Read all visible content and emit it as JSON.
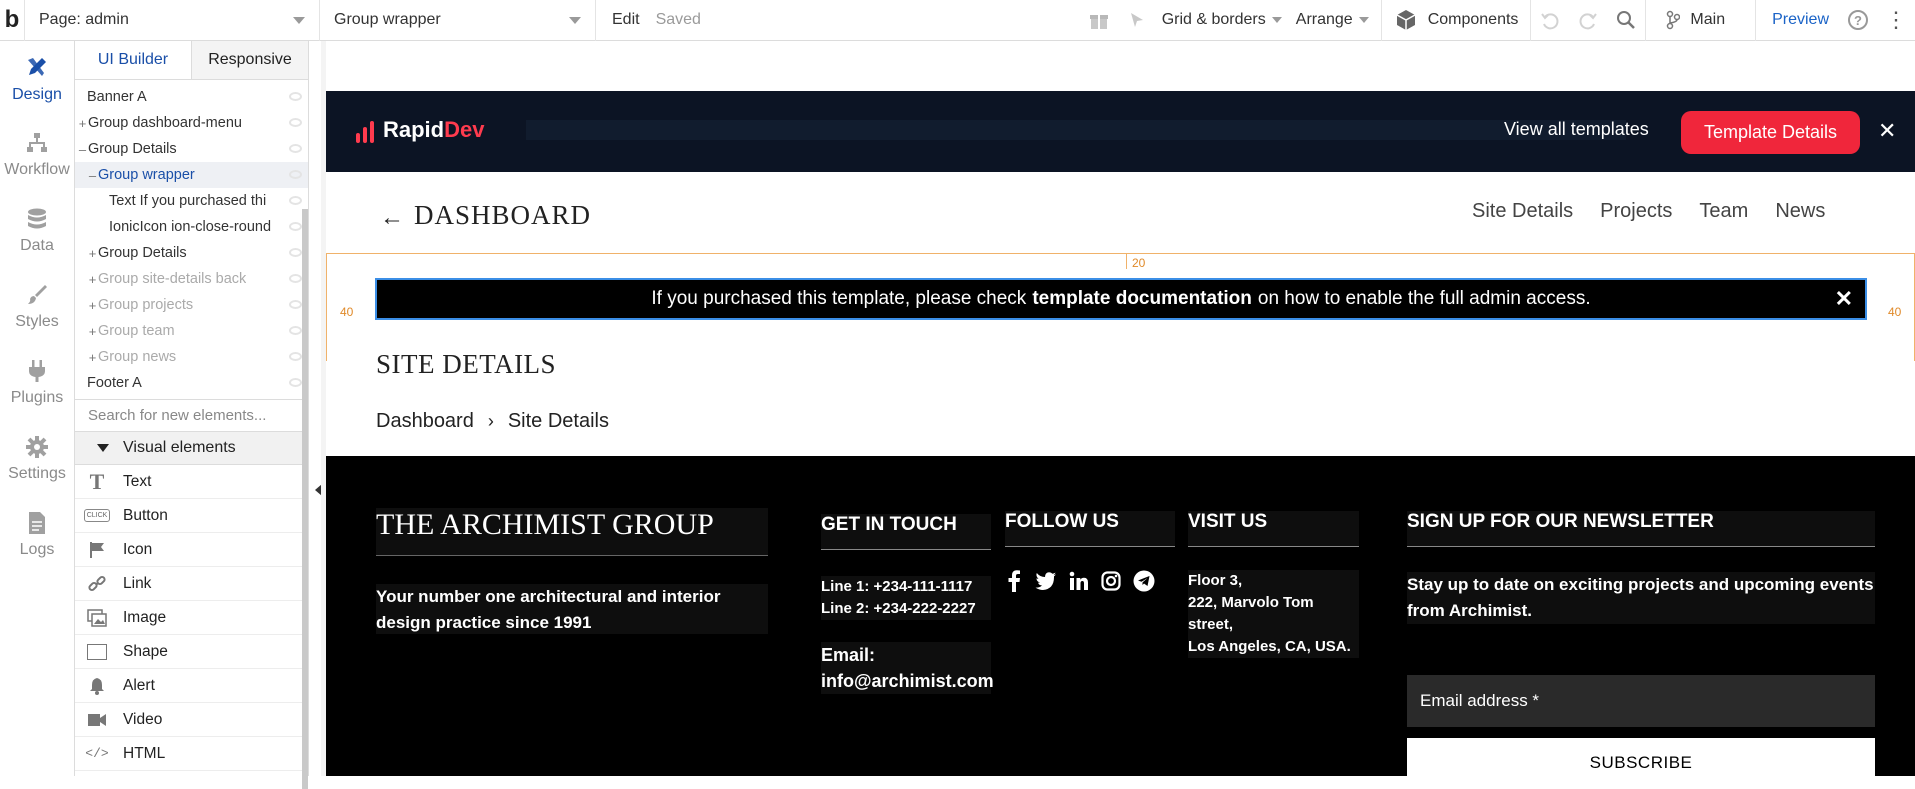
{
  "toolbar": {
    "logo": "b",
    "page_select": "Page: admin",
    "element_select": "Group wrapper",
    "edit": "Edit",
    "saved": "Saved",
    "grid_borders": "Grid & borders",
    "arrange": "Arrange",
    "components": "Components",
    "branch": "Main",
    "preview": "Preview",
    "help": "?"
  },
  "rail": {
    "items": [
      {
        "label": "Design",
        "icon": "pencil-icon"
      },
      {
        "label": "Workflow",
        "icon": "workflow-icon"
      },
      {
        "label": "Data",
        "icon": "database-icon"
      },
      {
        "label": "Styles",
        "icon": "brush-icon"
      },
      {
        "label": "Plugins",
        "icon": "plug-icon"
      },
      {
        "label": "Settings",
        "icon": "gear-icon"
      },
      {
        "label": "Logs",
        "icon": "document-icon"
      }
    ]
  },
  "panel": {
    "tabs": [
      "UI Builder",
      "Responsive"
    ],
    "tree": [
      {
        "label": "Banner A"
      },
      {
        "label": "Group dashboard-menu"
      },
      {
        "label": "Group Details"
      },
      {
        "label": "Group wrapper"
      },
      {
        "label": "Text If you purchased thi"
      },
      {
        "label": "IonicIcon ion-close-round"
      },
      {
        "label": "Group Details"
      },
      {
        "label": "Group site-details back"
      },
      {
        "label": "Group projects"
      },
      {
        "label": "Group team"
      },
      {
        "label": "Group news"
      },
      {
        "label": "Footer A"
      }
    ],
    "search_placeholder": "Search for new elements...",
    "visual_elements_header": "Visual elements",
    "elements": [
      "Text",
      "Button",
      "Icon",
      "Link",
      "Image",
      "Shape",
      "Alert",
      "Video",
      "HTML"
    ],
    "button_icon_text": "CLICK"
  },
  "banner": {
    "brand_main": "Rapid",
    "brand_accent": "Dev",
    "view_all": "View all templates",
    "template_details": "Template Details",
    "close": "✕"
  },
  "dashboard": {
    "back": "←",
    "title": "DASHBOARD",
    "nav": [
      "Site Details",
      "Projects",
      "Team",
      "News"
    ]
  },
  "guides": {
    "top_margin": "20",
    "left_margin": "40",
    "right_margin": "40"
  },
  "notice": {
    "pre": "If you purchased this template, please check",
    "bold": "template documentation",
    "post": "on how to enable the full admin access.",
    "close": "✕"
  },
  "site_details": {
    "title": "SITE DETAILS",
    "breadcrumb_root": "Dashboard",
    "breadcrumb_sep": "›",
    "breadcrumb_current": "Site Details"
  },
  "footer": {
    "brand": "THE ARCHIMIST GROUP",
    "tagline": "Your number one architectural and interior design practice since 1991",
    "get_in_touch": "GET IN TOUCH",
    "line1": "Line 1:  +234-111-1117",
    "line2": "Line 2: +234-222-2227",
    "email_label": "Email:",
    "email_value": "info@archimist.com",
    "follow_us": "FOLLOW US",
    "visit_us": "VISIT US",
    "address": [
      "Floor 3,",
      "222, Marvolo Tom",
      "street,",
      "Los Angeles, CA, USA."
    ],
    "newsletter": "SIGN UP FOR OUR NEWSLETTER",
    "newsletter_text": "Stay up to date on exciting projects and upcoming events from Archimist.",
    "email_placeholder": "Email address *",
    "subscribe": "SUBSCRIBE"
  },
  "colors": {
    "accent_blue": "#1a4fa8",
    "banner_bg": "#0c1424",
    "brand_red": "#f0263b",
    "guide_orange": "#f0b26a"
  }
}
